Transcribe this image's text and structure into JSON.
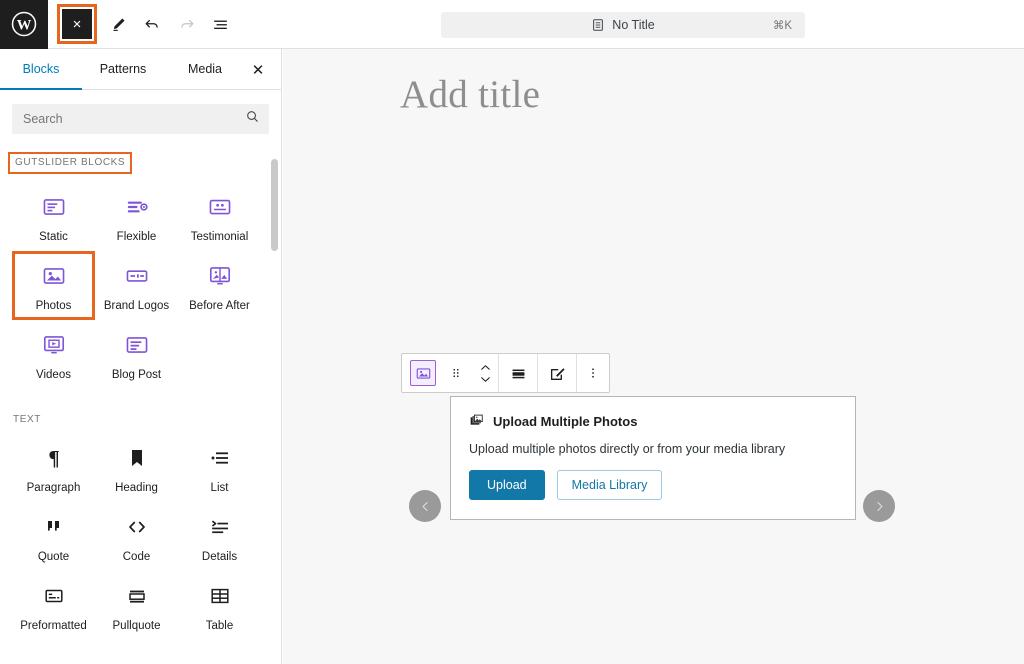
{
  "topbar": {
    "logo_icon": "wordpress-logo-icon",
    "inserter": {
      "icon": "close-x-icon",
      "label": "×",
      "highlighted": true
    },
    "tools": [
      {
        "name": "edit-pencil-icon",
        "state": "active"
      },
      {
        "name": "undo-icon",
        "state": "active"
      },
      {
        "name": "redo-icon",
        "state": "disabled"
      },
      {
        "name": "list-view-icon",
        "state": "active"
      }
    ],
    "command_bar": {
      "icon": "document-icon",
      "text": "No Title",
      "shortcut": "⌘K"
    }
  },
  "sidebar": {
    "tabs": [
      {
        "label": "Blocks",
        "active": true
      },
      {
        "label": "Patterns",
        "active": false
      },
      {
        "label": "Media",
        "active": false
      }
    ],
    "close_label": "✕",
    "search": {
      "placeholder": "Search",
      "value": ""
    },
    "sections": [
      {
        "title": "GUTSLIDER BLOCKS",
        "highlighted": true,
        "blocks": [
          {
            "label": "Static",
            "icon": "static-slide-icon",
            "highlighted": false
          },
          {
            "label": "Flexible",
            "icon": "flexible-slide-icon",
            "highlighted": false
          },
          {
            "label": "Testimonial",
            "icon": "testimonial-icon",
            "highlighted": false
          },
          {
            "label": "Photos",
            "icon": "photos-icon",
            "highlighted": true
          },
          {
            "label": "Brand Logos",
            "icon": "brand-logos-icon",
            "highlighted": false
          },
          {
            "label": "Before After",
            "icon": "before-after-icon",
            "highlighted": false
          },
          {
            "label": "Videos",
            "icon": "videos-icon",
            "highlighted": false
          },
          {
            "label": "Blog Post",
            "icon": "blog-post-icon",
            "highlighted": false
          }
        ]
      },
      {
        "title": "TEXT",
        "highlighted": false,
        "blocks": [
          {
            "label": "Paragraph",
            "icon": "paragraph-icon",
            "highlighted": false
          },
          {
            "label": "Heading",
            "icon": "heading-icon",
            "highlighted": false
          },
          {
            "label": "List",
            "icon": "list-icon",
            "highlighted": false
          },
          {
            "label": "Quote",
            "icon": "quote-icon",
            "highlighted": false
          },
          {
            "label": "Code",
            "icon": "code-icon",
            "highlighted": false
          },
          {
            "label": "Details",
            "icon": "details-icon",
            "highlighted": false
          },
          {
            "label": "Preformatted",
            "icon": "preformatted-icon",
            "highlighted": false
          },
          {
            "label": "Pullquote",
            "icon": "pullquote-icon",
            "highlighted": false
          },
          {
            "label": "Table",
            "icon": "table-icon",
            "highlighted": false
          }
        ]
      }
    ]
  },
  "canvas": {
    "title_placeholder": "Add title",
    "block_toolbar": {
      "items": [
        {
          "name": "block-type-photos-icon",
          "selected": true
        },
        {
          "name": "drag-handle-icon",
          "selected": false
        },
        {
          "name": "move-up-down-icon",
          "selected": false
        },
        {
          "name": "align-icon",
          "selected": false
        },
        {
          "name": "edit-icon",
          "selected": false
        },
        {
          "name": "more-options-icon",
          "selected": false
        }
      ]
    },
    "upload_panel": {
      "icon": "multiple-photos-icon",
      "heading": "Upload Multiple Photos",
      "description": "Upload multiple photos directly or from your media library",
      "primary_button": "Upload",
      "secondary_button": "Media Library"
    },
    "carousel": {
      "prev_label": "‹",
      "next_label": "›"
    }
  },
  "colors": {
    "accent_blue": "#007cba",
    "highlight_orange": "#e8651f",
    "block_purple": "#7f54d8",
    "upload_blue": "#1278a8",
    "canvas_bg": "#f7f7f7"
  }
}
